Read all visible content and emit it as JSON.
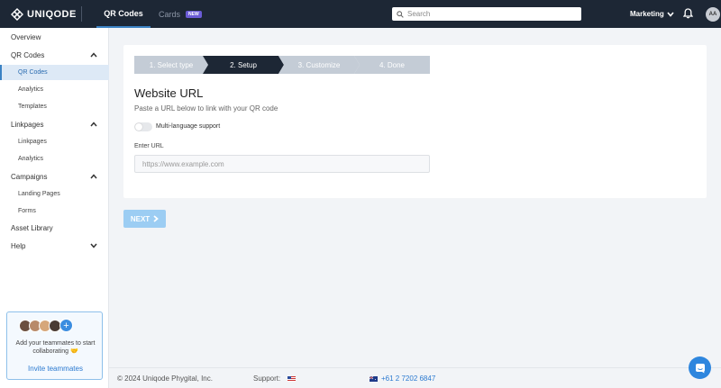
{
  "app": {
    "logo_text": "UNIQODE"
  },
  "topnav": {
    "tabs": [
      {
        "label": "QR Codes"
      },
      {
        "label": "Cards",
        "badge": "NEW"
      }
    ],
    "search_placeholder": "Search",
    "workspace": "Marketing",
    "avatar_initials": "AA"
  },
  "sidebar": {
    "items": [
      {
        "label": "Overview"
      },
      {
        "label": "QR Codes"
      },
      {
        "label": "QR Codes"
      },
      {
        "label": "Analytics"
      },
      {
        "label": "Templates"
      },
      {
        "label": "Linkpages"
      },
      {
        "label": "Linkpages"
      },
      {
        "label": "Analytics"
      },
      {
        "label": "Campaigns"
      },
      {
        "label": "Landing Pages"
      },
      {
        "label": "Forms"
      },
      {
        "label": "Asset Library"
      },
      {
        "label": "Help"
      }
    ],
    "invite": {
      "text": "Add your teammates to start collaborating 🤝",
      "link": "Invite teammates"
    }
  },
  "wizard": {
    "steps": [
      {
        "label": "1. Select type"
      },
      {
        "label": "2. Setup"
      },
      {
        "label": "3. Customize"
      },
      {
        "label": "4. Done"
      }
    ],
    "title": "Website URL",
    "subtitle": "Paste a URL below to link with your QR code",
    "toggle_label": "Multi-language support",
    "url_label": "Enter URL",
    "url_placeholder": "https://www.example.com",
    "url_value": "",
    "next_label": "NEXT"
  },
  "footer": {
    "copyright": "© 2024 Uniqode Phygital, Inc.",
    "support_label": "Support:",
    "phone": "+61 2 7202 6847"
  },
  "colors": {
    "topbar": "#1d2735",
    "accent": "#3b82c4",
    "active_step": "#1d2735",
    "inactive_step": "#c4ccd6",
    "next_button": "#9ccdf3"
  }
}
